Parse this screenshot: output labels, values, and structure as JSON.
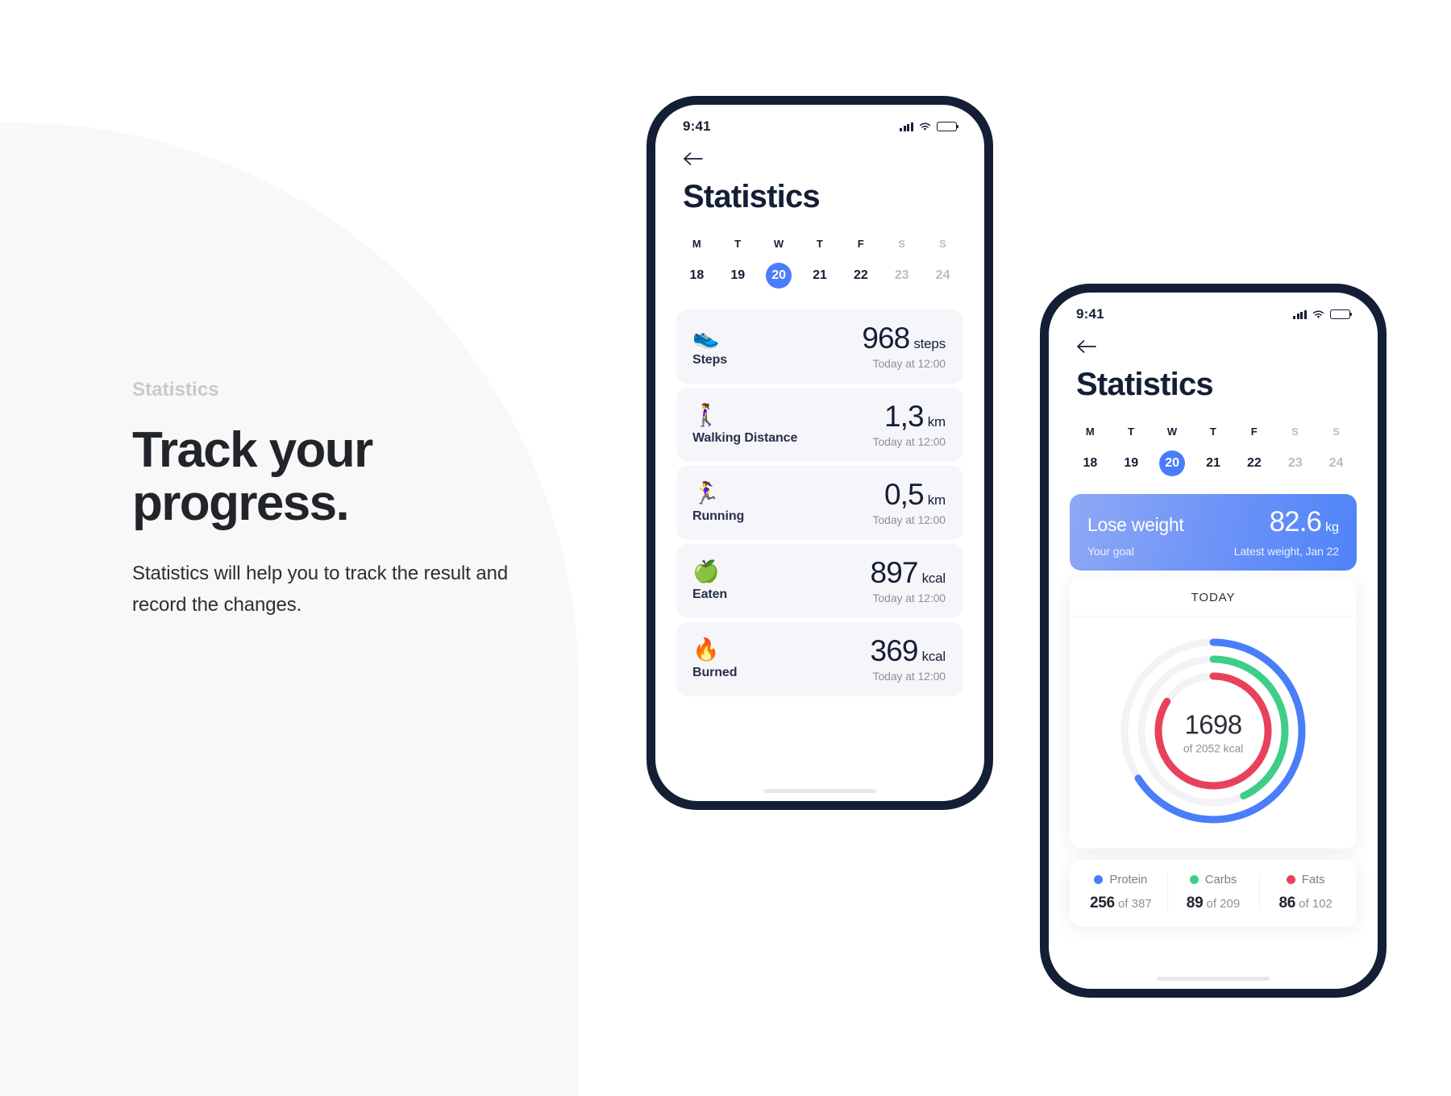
{
  "promo": {
    "eyebrow": "Statistics",
    "headline_line1": "Track your",
    "headline_line2": "progress.",
    "body": "Statistics will help you to track the result and record the changes."
  },
  "colors": {
    "accent_blue": "#4a7dfa",
    "ring_protein": "#4a7dfa",
    "ring_carbs": "#3dcf87",
    "ring_fats": "#e8415c",
    "frame": "#141f35",
    "card_bg": "#f6f6fa",
    "panel_bg": "#f8f8f9"
  },
  "phone_one": {
    "status": {
      "time": "9:41",
      "signal_icon": "cellular-bars-icon",
      "wifi_icon": "wifi-icon",
      "battery_icon": "battery-full-icon"
    },
    "back_icon": "arrow-left-icon",
    "title": "Statistics",
    "week": [
      {
        "letter": "M",
        "num": "18",
        "active": false,
        "weekend": false
      },
      {
        "letter": "T",
        "num": "19",
        "active": false,
        "weekend": false
      },
      {
        "letter": "W",
        "num": "20",
        "active": true,
        "weekend": false
      },
      {
        "letter": "T",
        "num": "21",
        "active": false,
        "weekend": false
      },
      {
        "letter": "F",
        "num": "22",
        "active": false,
        "weekend": false
      },
      {
        "letter": "S",
        "num": "23",
        "active": false,
        "weekend": true
      },
      {
        "letter": "S",
        "num": "24",
        "active": false,
        "weekend": true
      }
    ],
    "stats": [
      {
        "icon": "running-shoe-icon",
        "emoji": "👟",
        "label": "Steps",
        "value": "968",
        "unit": "steps",
        "time": "Today at 12:00"
      },
      {
        "icon": "walking-person-icon",
        "emoji": "🚶‍♀️",
        "label": "Walking Distance",
        "value": "1,3",
        "unit": "km",
        "time": "Today at 12:00"
      },
      {
        "icon": "running-person-icon",
        "emoji": "🏃‍♀️",
        "label": "Running",
        "value": "0,5",
        "unit": "km",
        "time": "Today at 12:00"
      },
      {
        "icon": "green-apple-icon",
        "emoji": "🍏",
        "label": "Eaten",
        "value": "897",
        "unit": "kcal",
        "time": "Today at 12:00"
      },
      {
        "icon": "fire-icon",
        "emoji": "🔥",
        "label": "Burned",
        "value": "369",
        "unit": "kcal",
        "time": "Today at 12:00"
      }
    ]
  },
  "phone_two": {
    "status": {
      "time": "9:41",
      "signal_icon": "cellular-bars-icon",
      "wifi_icon": "wifi-icon",
      "battery_icon": "battery-full-icon"
    },
    "back_icon": "arrow-left-icon",
    "title": "Statistics",
    "week": [
      {
        "letter": "M",
        "num": "18",
        "active": false,
        "weekend": false
      },
      {
        "letter": "T",
        "num": "19",
        "active": false,
        "weekend": false
      },
      {
        "letter": "W",
        "num": "20",
        "active": true,
        "weekend": false
      },
      {
        "letter": "T",
        "num": "21",
        "active": false,
        "weekend": false
      },
      {
        "letter": "F",
        "num": "22",
        "active": false,
        "weekend": false
      },
      {
        "letter": "S",
        "num": "23",
        "active": false,
        "weekend": true
      },
      {
        "letter": "S",
        "num": "24",
        "active": false,
        "weekend": true
      }
    ],
    "goal_card": {
      "title": "Lose weight",
      "subtitle": "Your goal",
      "weight": "82.6",
      "weight_unit": "kg",
      "weight_caption": "Latest weight, Jan 22"
    },
    "today_card": {
      "header": "TODAY",
      "calories_consumed": "1698",
      "calories_of": "of 2052 kcal"
    },
    "macros": [
      {
        "name": "Protein",
        "color": "#4a7dfa",
        "value": "256",
        "of": "of 387"
      },
      {
        "name": "Carbs",
        "color": "#3dcf87",
        "value": "89",
        "of": "of 209"
      },
      {
        "name": "Fats",
        "color": "#e8415c",
        "value": "86",
        "of": "of 102"
      }
    ]
  },
  "chart_data": {
    "type": "pie",
    "title": "TODAY",
    "subtitle": "1698 of 2052 kcal",
    "legend_position": "bottom",
    "series": [
      {
        "name": "Protein",
        "value": 256,
        "target": 387,
        "pct": 66,
        "color": "#4a7dfa",
        "ring": "outer"
      },
      {
        "name": "Carbs",
        "value": 89,
        "target": 209,
        "pct": 43,
        "color": "#3dcf87",
        "ring": "middle"
      },
      {
        "name": "Fats",
        "value": 86,
        "target": 102,
        "pct": 84,
        "color": "#e8415c",
        "ring": "inner"
      }
    ],
    "center_value": 1698,
    "center_total": 2052,
    "center_unit": "kcal",
    "track_color": "#f3f3f7"
  }
}
